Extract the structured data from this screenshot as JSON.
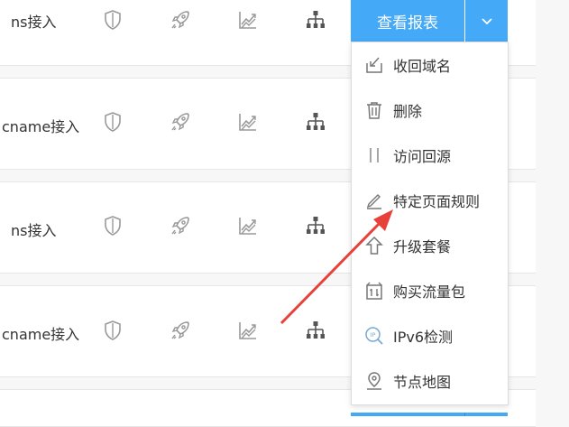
{
  "rows": [
    {
      "access": "ns接入"
    },
    {
      "access": "cname接入"
    },
    {
      "access": "ns接入"
    },
    {
      "access": "cname接入"
    }
  ],
  "report_button": {
    "label": "查看报表"
  },
  "dropdown_menu": {
    "items": [
      {
        "label": "收回域名",
        "icon": "retrieve-icon"
      },
      {
        "label": "删除",
        "icon": "trash-icon"
      },
      {
        "label": "访问回源",
        "icon": "origin-icon"
      },
      {
        "label": "特定页面规则",
        "icon": "pencil-icon"
      },
      {
        "label": "升级套餐",
        "icon": "upgrade-arrow-icon"
      },
      {
        "label": "购买流量包",
        "icon": "traffic-package-icon"
      },
      {
        "label": "IPv6检测",
        "icon": "ipv6-detect-icon"
      },
      {
        "label": "节点地图",
        "icon": "map-pin-icon"
      }
    ]
  },
  "colors": {
    "accent": "#44a9f6",
    "annotation_arrow": "#e8413a",
    "icon": "#9a9a9a"
  }
}
